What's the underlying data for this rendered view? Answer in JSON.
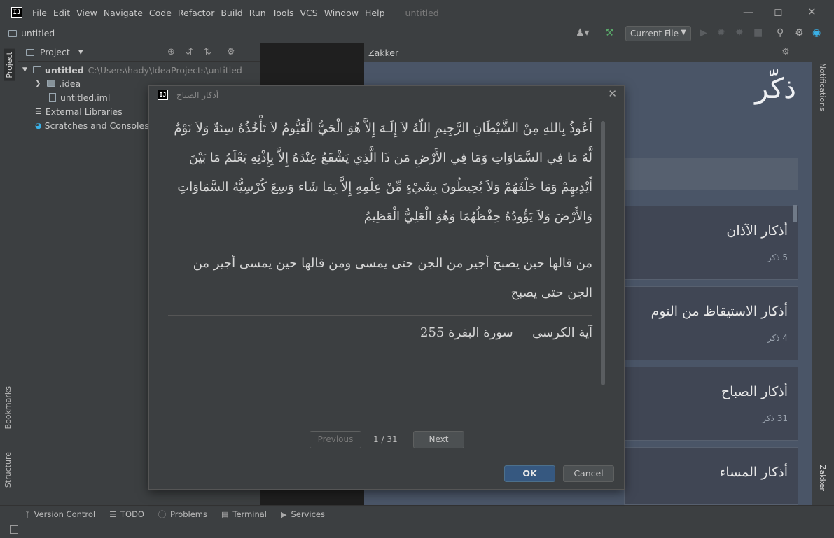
{
  "window": {
    "title": "untitled",
    "menu": [
      "File",
      "Edit",
      "View",
      "Navigate",
      "Code",
      "Refactor",
      "Build",
      "Run",
      "Tools",
      "VCS",
      "Window",
      "Help"
    ]
  },
  "toolbar": {
    "project_crumb": "untitled",
    "run_config": "Current File"
  },
  "left_stripe": {
    "project": "Project",
    "bookmarks": "Bookmarks",
    "structure": "Structure"
  },
  "right_stripe": {
    "notifications": "Notifications",
    "zakker": "Zakker"
  },
  "project_panel": {
    "title": "Project",
    "tree": [
      {
        "label": "untitled",
        "path": "C:\\Users\\hady\\IdeaProjects\\untitled"
      },
      {
        "label": ".idea"
      },
      {
        "label": "untitled.iml"
      },
      {
        "label": "External Libraries"
      },
      {
        "label": "Scratches and Consoles"
      }
    ]
  },
  "zakker_panel": {
    "title": "Zakker",
    "app_title": "ذكّر",
    "cards": [
      {
        "title": "أذكار الآذان",
        "count": "5 ذكر"
      },
      {
        "title": "أذكار الاستيقاظ من النوم",
        "count": "4 ذكر"
      },
      {
        "title": "أذكار الصباح",
        "count": "31 ذكر"
      },
      {
        "title": "أذكار المساء",
        "count": ""
      }
    ]
  },
  "dialog": {
    "title": "أذكار الصباح",
    "verse": "أَعُوذُ بِاللهِ مِنْ الشَّيْطَانِ الرَّجِيمِ اللّهُ لاَ إِلَـهَ إِلاَّ هُوَ الْحَيُّ الْقَيُّومُ لاَ تَأْخُذُهُ سِنَةٌ وَلاَ نَوْمٌ لَّهُ مَا فِي السَّمَاوَاتِ وَمَا فِي الأَرْضِ مَن ذَا الَّذِي يَشْفَعُ عِنْدَهُ إِلاَّ بِإِذْنِهِ يَعْلَمُ مَا بَيْنَ أَيْدِيهِمْ وَمَا خَلْفَهُمْ وَلاَ يُحِيطُونَ بِشَيْءٍ مِّنْ عِلْمِهِ إِلاَّ بِمَا شَاء وَسِعَ كُرْسِيُّهُ السَّمَاوَاتِ وَالأَرْضَ وَلاَ يَؤُودُهُ حِفْظُهُمَا وَهُوَ الْعَلِيُّ الْعَظِيمُ",
    "virtue": "من قالها حين يصبح أجير من الجن حتى يمسى ومن قالها حين يمسى أجير من الجن حتى يصبح",
    "reference_name": "آية الكرسى",
    "reference_surah": "سورة البقرة 255",
    "previous": "Previous",
    "next": "Next",
    "page": "1 / 31",
    "ok": "OK",
    "cancel": "Cancel"
  },
  "bottom_tabs": [
    "Version Control",
    "TODO",
    "Problems",
    "Terminal",
    "Services"
  ]
}
